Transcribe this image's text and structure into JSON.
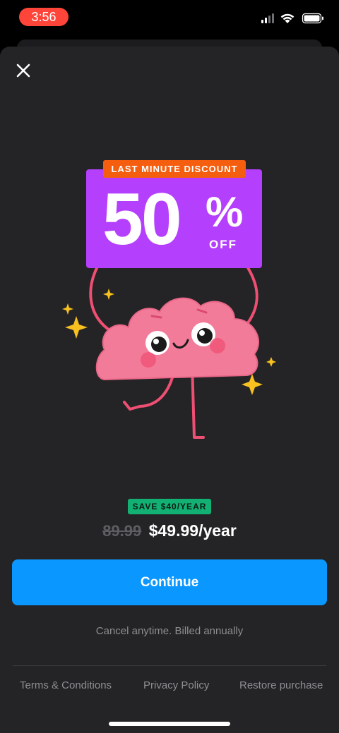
{
  "status_bar": {
    "time": "3:56",
    "icons": [
      "cellular-signal-icon",
      "wifi-icon",
      "battery-icon"
    ],
    "time_pill_color": "#ff453a"
  },
  "header": {
    "close_icon": "close-icon"
  },
  "promo": {
    "ribbon_label": "LAST MINUTE DISCOUNT",
    "discount_number": "50",
    "percent_sign": "%",
    "off_label": "OFF",
    "badge_color": "#b43ffd",
    "ribbon_color": "#f55e0f",
    "mascot": "brain-mascot-illustration"
  },
  "pricing": {
    "save_badge": "SAVE $40/YEAR",
    "old_price": "89.99",
    "new_price": "$49.99/year",
    "save_badge_color": "#12b073"
  },
  "cta": {
    "continue_label": "Continue",
    "color": "#0a97ff"
  },
  "notes": {
    "cancel_note": "Cancel anytime. Billed annually"
  },
  "footer": {
    "terms": "Terms & Conditions",
    "privacy": "Privacy Policy",
    "restore": "Restore purchase"
  }
}
